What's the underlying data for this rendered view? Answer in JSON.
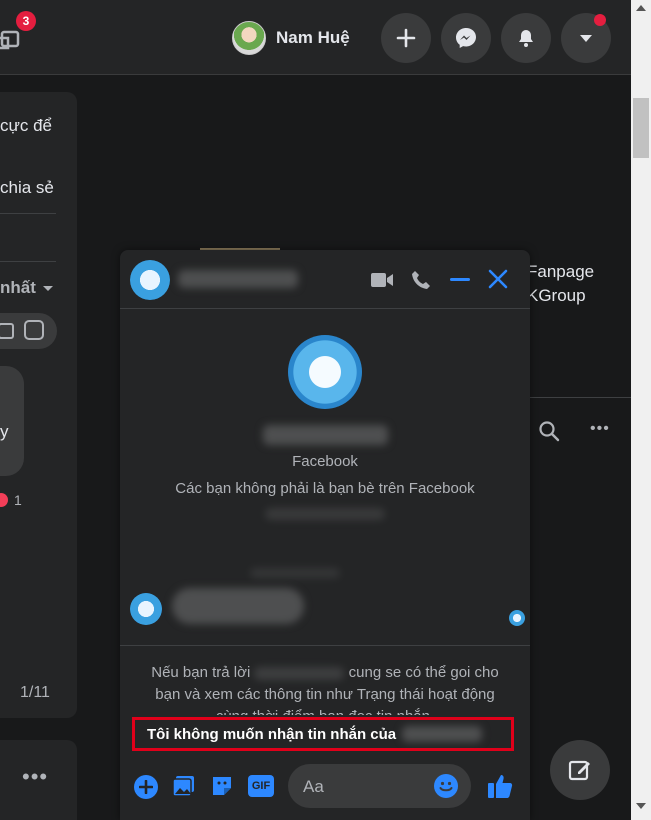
{
  "header": {
    "notification_count": "3",
    "user_name": "Nam Huệ"
  },
  "left_panel": {
    "text1": "cực để",
    "text2": "chia sẻ",
    "sort_label": "nhất",
    "text3": "y",
    "reaction_count": "1",
    "pager": "1/11"
  },
  "right_panel": {
    "post_text_line1": "Fanpage",
    "post_text_line2": "KGroup"
  },
  "chat": {
    "profile_caption": "Facebook",
    "not_friends": "Các bạn không phải là bạn bè trên Facebook",
    "notice_lines": [
      "Nếu bạn trả lời",
      "cung se có thể goi cho",
      "bạn và xem các thông tin như Trạng thái hoạt động",
      "cùng thời điểm bạn đọc tin nhắn."
    ],
    "decline_label": "Tôi không muốn nhận tin nhắn của",
    "input_placeholder": "Aa"
  },
  "colors": {
    "accent": "#2d88ff",
    "highlight_border": "#e0001a",
    "badge": "#e41e3f"
  }
}
